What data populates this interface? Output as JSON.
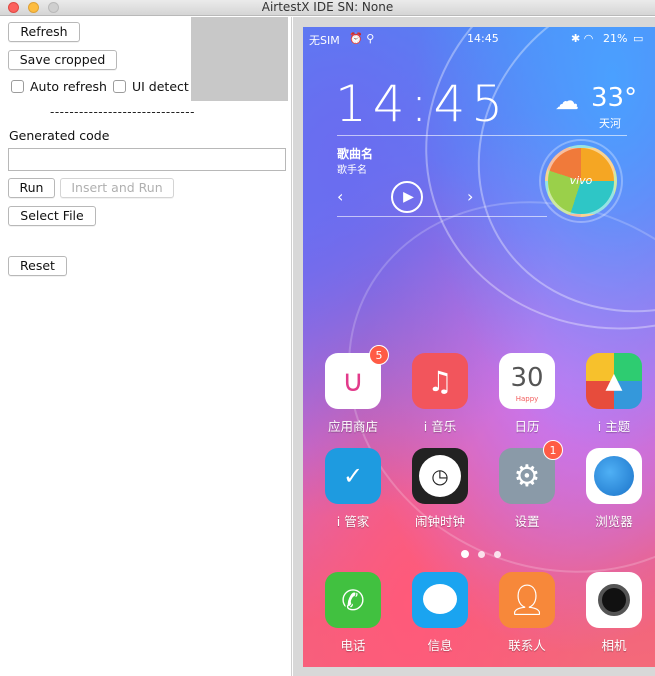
{
  "window": {
    "title": "AirtestX IDE SN: None"
  },
  "toolbar": {
    "refresh_label": "Refresh",
    "save_cropped_label": "Save cropped",
    "auto_refresh_label": "Auto refresh",
    "ui_detect_label": "UI detect",
    "separator": "------------------------------",
    "generated_code_label": "Generated code",
    "generated_code_value": "",
    "run_label": "Run",
    "insert_run_label": "Insert and Run",
    "select_file_label": "Select File",
    "reset_label": "Reset"
  },
  "phone": {
    "status": {
      "carrier": "无SIM",
      "time": "14:45",
      "battery": "21%"
    },
    "widget": {
      "clock": "14:45",
      "temperature": "33°",
      "city": "天河",
      "song_title": "歌曲名",
      "artist": "歌手名",
      "brand": "vivo"
    },
    "apps_row1": [
      {
        "label": "应用商店",
        "badge": "5",
        "icon": "app-store-icon",
        "color": "#ffffff"
      },
      {
        "label": "i 音乐",
        "badge": "",
        "icon": "music-icon",
        "color": "#f2555c"
      },
      {
        "label": "日历",
        "badge": "",
        "icon": "calendar-icon",
        "color": "#ffffff",
        "day": "30",
        "sub": "Happy"
      },
      {
        "label": "i 主题",
        "badge": "",
        "icon": "theme-icon",
        "color": "#f7c12c"
      }
    ],
    "apps_row2": [
      {
        "label": "i 管家",
        "badge": "",
        "icon": "shield-icon",
        "color": "#1e9be0"
      },
      {
        "label": "闹钟时钟",
        "badge": "",
        "icon": "clock-icon",
        "color": "#222222"
      },
      {
        "label": "设置",
        "badge": "1",
        "icon": "gear-icon",
        "color": "#8a9aa8"
      },
      {
        "label": "浏览器",
        "badge": "",
        "icon": "globe-icon",
        "color": "#ffffff"
      }
    ],
    "dock": [
      {
        "label": "电话",
        "icon": "phone-icon",
        "color": "#41c140"
      },
      {
        "label": "信息",
        "icon": "message-icon",
        "color": "#1aa4f0"
      },
      {
        "label": "联系人",
        "icon": "contacts-icon",
        "color": "#f7883a"
      },
      {
        "label": "相机",
        "icon": "camera-icon",
        "color": "#ffffff"
      }
    ]
  }
}
